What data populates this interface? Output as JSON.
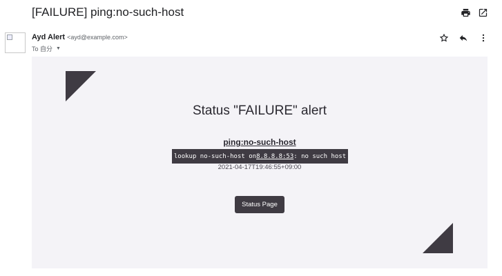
{
  "email": {
    "subject": "[FAILURE] ping:no-such-host",
    "sender_name": "Ayd Alert",
    "sender_email": "<ayd@example.com>",
    "to_label": "To 自分"
  },
  "toolbar": {
    "print_icon": "print-icon",
    "open_new_window_icon": "open-in-new-icon",
    "star_icon": "star-icon",
    "reply_icon": "reply-icon",
    "more_icon": "more-vert-icon"
  },
  "alert": {
    "title": "Status \"FAILURE\" alert",
    "target": "ping:no-such-host",
    "message_prefix": "lookup no-such-host on ",
    "message_link": "8.8.8.8:53",
    "message_suffix": ": no such host",
    "timestamp": "2021-04-17T19:46:55+09:00",
    "button_label": "Status Page"
  },
  "colors": {
    "body_bg": "#f4f3f7",
    "accent_dark": "#3f3b43",
    "text": "#202124"
  }
}
